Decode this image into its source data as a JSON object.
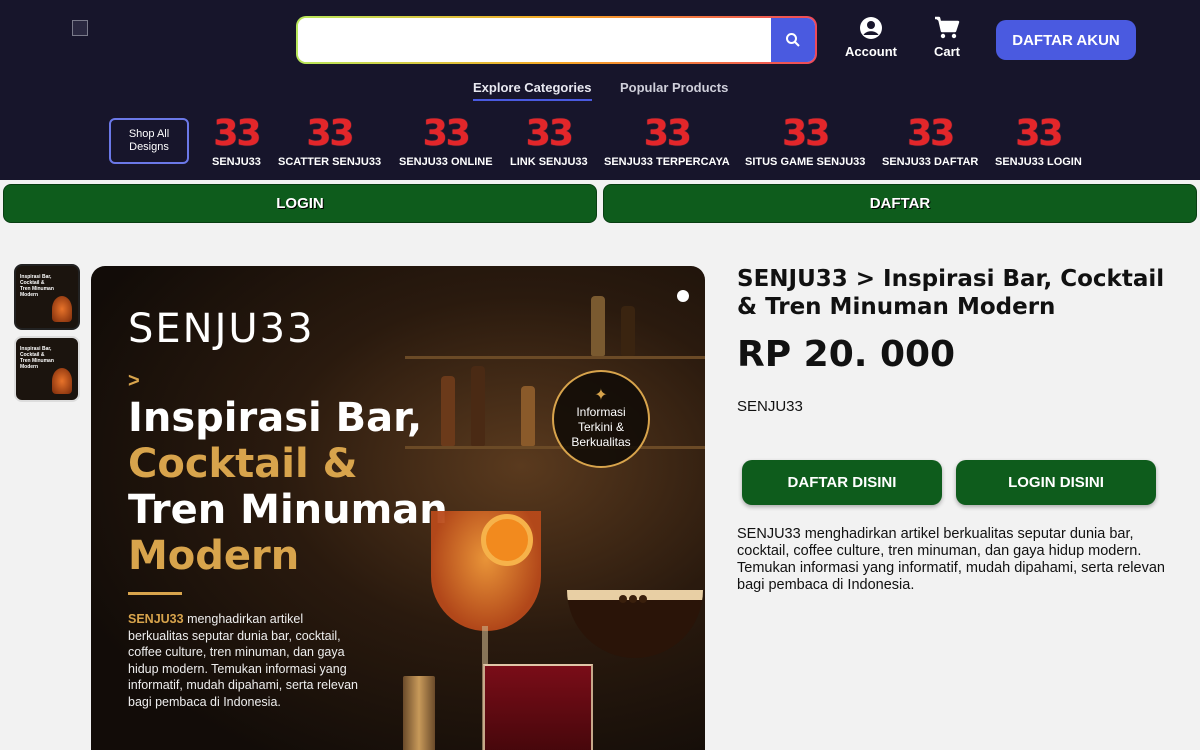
{
  "header": {
    "search": {
      "value": "",
      "placeholder": ""
    },
    "account_label": "Account",
    "cart_label": "Cart",
    "register_button": "DAFTAR AKUN",
    "tabs": [
      {
        "label": "Explore Categories",
        "active": true
      },
      {
        "label": "Popular Products",
        "active": false
      }
    ],
    "shop_all": "Shop All Designs",
    "categories": [
      {
        "num": "33",
        "label": "SENJU33"
      },
      {
        "num": "33",
        "label": "SCATTER SENJU33"
      },
      {
        "num": "33",
        "label": "SENJU33 ONLINE"
      },
      {
        "num": "33",
        "label": "LINK SENJU33"
      },
      {
        "num": "33",
        "label": "SENJU33 TERPERCAYA"
      },
      {
        "num": "33",
        "label": "SITUS GAME SENJU33"
      },
      {
        "num": "33",
        "label": "SENJU33 DAFTAR"
      },
      {
        "num": "33",
        "label": "SENJU33 LOGIN"
      }
    ]
  },
  "bars": {
    "login": "LOGIN",
    "daftar": "DAFTAR"
  },
  "thumbnails": [
    {
      "text": "Inspirasi Bar, Cocktail & Tren Minuman Modern"
    },
    {
      "text": "Inspirasi Bar, Cocktail & Tren Minuman Modern"
    }
  ],
  "hero": {
    "brand": "SENJU33",
    "arrow": ">",
    "line1": "Inspirasi Bar,",
    "line2": "Cocktail &",
    "line3": "Tren Minuman",
    "line4": "Modern",
    "desc_bold": "SENJU33",
    "desc_rest": " menghadirkan artikel berkualitas seputar dunia bar, cocktail, coffee culture, tren minuman, dan gaya hidup modern. Temukan informasi yang informatif, mudah dipahami, serta relevan bagi pembaca di Indonesia.",
    "badge": "Informasi Terkini & Berkualitas"
  },
  "product": {
    "title": "SENJU33 > Inspirasi Bar, Cocktail & Tren Minuman Modern",
    "price": "RP 20. 000",
    "vendor": "SENJU33",
    "daftar_button": "DAFTAR DISINI",
    "login_button": "LOGIN DISINI",
    "description": "SENJU33 menghadirkan artikel berkualitas seputar dunia bar, cocktail, coffee culture, tren minuman, dan gaya hidup modern. Temukan informasi yang informatif, mudah dipahami, serta relevan bagi pembaca di Indonesia."
  },
  "colors": {
    "header_bg": "#17152b",
    "accent": "#4a5ae0",
    "green": "#0e5c1c",
    "category_red": "#e3262a",
    "gold": "#d8a44c"
  }
}
